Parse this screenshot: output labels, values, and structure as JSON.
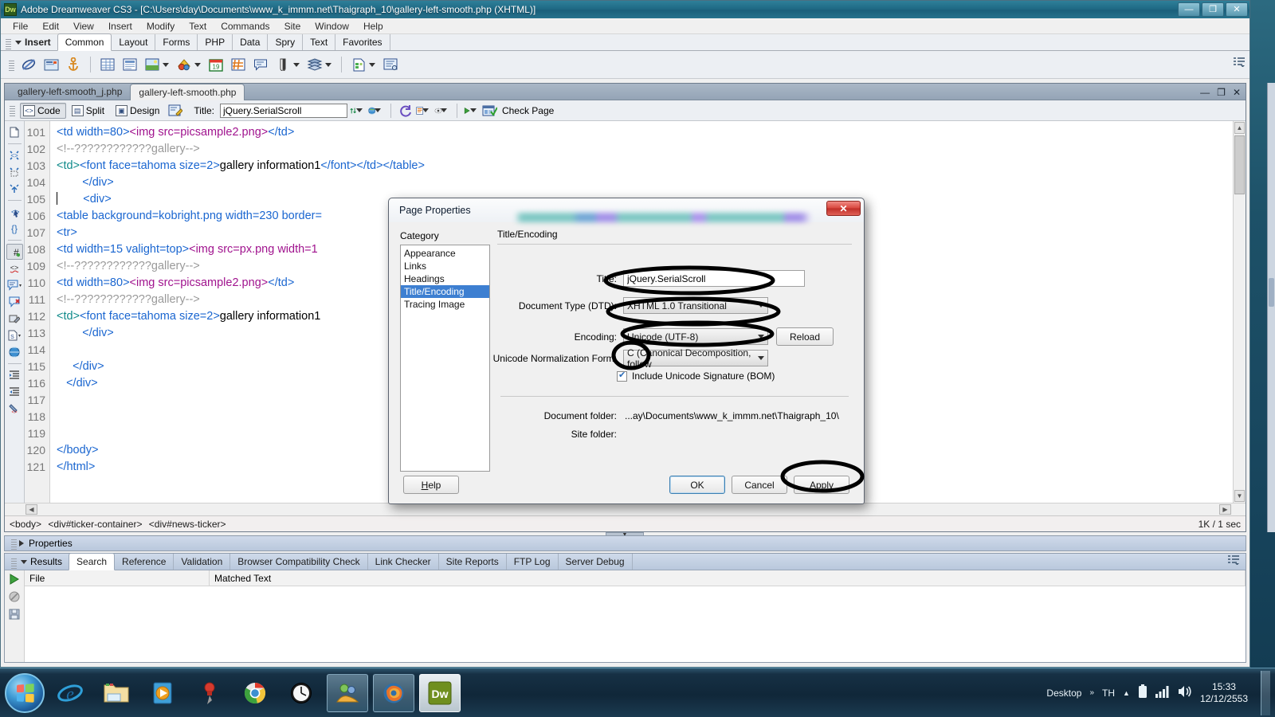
{
  "window": {
    "title": "Adobe Dreamweaver CS3 - [C:\\Users\\day\\Documents\\www_k_immm.net\\Thaigraph_10\\gallery-left-smooth.php (XHTML)]",
    "logo_text": "Dw",
    "minimize": "—",
    "restore": "❐",
    "close": "✕"
  },
  "menubar": {
    "items": [
      "File",
      "Edit",
      "View",
      "Insert",
      "Modify",
      "Text",
      "Commands",
      "Site",
      "Window",
      "Help"
    ]
  },
  "insertbar": {
    "label": "Insert",
    "tabs": [
      "Common",
      "Layout",
      "Forms",
      "PHP",
      "Data",
      "Spry",
      "Text",
      "Favorites"
    ],
    "active_tab": "Common",
    "icons": [
      {
        "name": "hyperlink-icon",
        "glyph": "🔗"
      },
      {
        "name": "email-link-icon",
        "glyph": "✉"
      },
      {
        "name": "named-anchor-icon",
        "glyph": "⚓"
      },
      {
        "name": "table-icon",
        "glyph": "▦"
      },
      {
        "name": "insert-div-tag-icon",
        "glyph": "▤"
      },
      {
        "name": "image-icon",
        "glyph": "🖼"
      },
      {
        "name": "media-icon",
        "glyph": "🎬"
      },
      {
        "name": "date-icon",
        "glyph": "19"
      },
      {
        "name": "server-side-include-icon",
        "glyph": "#"
      },
      {
        "name": "comment-icon",
        "glyph": "💬"
      },
      {
        "name": "head-tag-icon",
        "glyph": "◑"
      },
      {
        "name": "script-icon",
        "glyph": "◈"
      },
      {
        "name": "templates-icon",
        "glyph": "📄"
      },
      {
        "name": "tag-chooser-icon",
        "glyph": "🗒"
      }
    ],
    "right_icon": "panel-options-icon"
  },
  "document": {
    "tabs": [
      {
        "label": "gallery-left-smooth_j.php",
        "active": false
      },
      {
        "label": "gallery-left-smooth.php",
        "active": true
      }
    ],
    "win_controls": [
      "—",
      "❐",
      "✕"
    ],
    "toolbar": {
      "view_buttons": [
        {
          "label": "Code",
          "active": true
        },
        {
          "label": "Split",
          "active": false
        },
        {
          "label": "Design",
          "active": false
        }
      ],
      "live_view_icon": "live-code-icon",
      "title_label": "Title:",
      "title_value": "jQuery.SerialScroll",
      "icons": [
        {
          "name": "file-management-icon",
          "glyph": "⇅"
        },
        {
          "name": "preview-in-browser-icon",
          "glyph": "🌐"
        },
        {
          "name": "refresh-design-view-icon",
          "glyph": "↻"
        },
        {
          "name": "view-options-icon",
          "glyph": "▤"
        },
        {
          "name": "visual-aids-icon",
          "glyph": "◎"
        },
        {
          "name": "validate-markup-icon",
          "glyph": "▶"
        }
      ],
      "check_page_label": "Check Page"
    },
    "code_sidebar_icons": [
      "open-documents-icon",
      "collapse-full-tag-icon",
      "collapse-outside-selection-icon",
      "expand-all-icon",
      "select-parent-tag-icon",
      "balance-braces-icon",
      "line-numbers-icon",
      "highlight-invalid-code-icon",
      "apply-comment-icon",
      "remove-comment-icon",
      "wrap-tag-icon",
      "recent-snippets-icon",
      "move-css-rules-icon",
      "indent-code-icon",
      "outdent-code-icon",
      "format-source-code-icon"
    ],
    "lines": [
      {
        "n": "101",
        "tokens": [
          {
            "t": "tag",
            "s": "<td width="
          },
          {
            "t": "num",
            "s": "80"
          },
          {
            "t": "tag",
            "s": ">"
          },
          {
            "t": "str",
            "s": "<img src=picsample2.png>"
          },
          {
            "t": "tag",
            "s": "</td>"
          }
        ]
      },
      {
        "n": "102",
        "tokens": [
          {
            "t": "cmt",
            "s": "<!--????????????gallery-->"
          }
        ]
      },
      {
        "n": "103",
        "tokens": [
          {
            "t": "tag2",
            "s": "<td>"
          },
          {
            "t": "tag",
            "s": "<font face=tahoma size="
          },
          {
            "t": "num",
            "s": "2"
          },
          {
            "t": "tag",
            "s": ">"
          },
          {
            "t": "txt",
            "s": "gallery information1"
          },
          {
            "t": "tag",
            "s": "</font></td></table>"
          }
        ]
      },
      {
        "n": "104",
        "tokens": [
          {
            "t": "tag",
            "s": "        </div>"
          }
        ]
      },
      {
        "n": "105",
        "tokens": [
          {
            "t": "caret",
            "s": ""
          },
          {
            "t": "tag",
            "s": "        <div>"
          }
        ]
      },
      {
        "n": "106",
        "tokens": [
          {
            "t": "tag",
            "s": "<table background=kobright.png width="
          },
          {
            "t": "num",
            "s": "230"
          },
          {
            "t": "tag",
            "s": " border="
          }
        ]
      },
      {
        "n": "107",
        "tokens": [
          {
            "t": "tag",
            "s": "<tr>"
          }
        ]
      },
      {
        "n": "108",
        "tokens": [
          {
            "t": "tag",
            "s": "<td width="
          },
          {
            "t": "num",
            "s": "15"
          },
          {
            "t": "tag",
            "s": " valight=top>"
          },
          {
            "t": "str",
            "s": "<img src=px.png width=1"
          }
        ]
      },
      {
        "n": "109",
        "tokens": [
          {
            "t": "cmt",
            "s": "<!--????????????gallery-->"
          }
        ]
      },
      {
        "n": "110",
        "tokens": [
          {
            "t": "tag",
            "s": "<td width="
          },
          {
            "t": "num",
            "s": "80"
          },
          {
            "t": "tag",
            "s": ">"
          },
          {
            "t": "str",
            "s": "<img src=picsample2.png>"
          },
          {
            "t": "tag",
            "s": "</td>"
          }
        ]
      },
      {
        "n": "111",
        "tokens": [
          {
            "t": "cmt",
            "s": "<!--????????????gallery-->"
          }
        ]
      },
      {
        "n": "112",
        "tokens": [
          {
            "t": "tag2",
            "s": "<td>"
          },
          {
            "t": "tag",
            "s": "<font face=tahoma size="
          },
          {
            "t": "num",
            "s": "2"
          },
          {
            "t": "tag",
            "s": ">"
          },
          {
            "t": "txt",
            "s": "gallery information1"
          }
        ]
      },
      {
        "n": "113",
        "tokens": [
          {
            "t": "tag",
            "s": "        </div>"
          }
        ]
      },
      {
        "n": "114",
        "tokens": []
      },
      {
        "n": "115",
        "tokens": [
          {
            "t": "tag",
            "s": "     </div>"
          }
        ]
      },
      {
        "n": "116",
        "tokens": [
          {
            "t": "tag",
            "s": "   </div>"
          }
        ]
      },
      {
        "n": "117",
        "tokens": []
      },
      {
        "n": "118",
        "tokens": []
      },
      {
        "n": "119",
        "tokens": []
      },
      {
        "n": "120",
        "tokens": [
          {
            "t": "tag",
            "s": "</body>"
          }
        ]
      },
      {
        "n": "121",
        "tokens": [
          {
            "t": "tag",
            "s": "</html>"
          }
        ]
      }
    ],
    "tag_selector": [
      "<body>",
      "<div#ticker-container>",
      "<div#news-ticker>"
    ],
    "doc_size": "1K / 1 sec"
  },
  "panels": {
    "properties_label": "Properties",
    "results_label": "Results",
    "results_tabs": [
      "Search",
      "Reference",
      "Validation",
      "Browser Compatibility Check",
      "Link Checker",
      "Site Reports",
      "FTP Log",
      "Server Debug"
    ],
    "results_active_tab": "Search",
    "results_columns": [
      "File",
      "Matched Text"
    ],
    "results_tool_icons": [
      "run-search-icon",
      "stop-icon",
      "save-report-icon"
    ],
    "results_right_icon": "panel-options-icon"
  },
  "dialog": {
    "title": "Page Properties",
    "close": "✕",
    "category_label": "Category",
    "categories": [
      {
        "label": "Appearance",
        "selected": false
      },
      {
        "label": "Links",
        "selected": false
      },
      {
        "label": "Headings",
        "selected": false
      },
      {
        "label": "Title/Encoding",
        "selected": true
      },
      {
        "label": "Tracing Image",
        "selected": false
      }
    ],
    "pane_title": "Title/Encoding",
    "fields": {
      "title_label": "Title:",
      "title_value": "jQuery.SerialScroll",
      "dtd_label": "Document Type (DTD):",
      "dtd_value": "XHTML 1.0 Transitional",
      "encoding_label": "Encoding:",
      "encoding_value": "Unicode (UTF-8)",
      "reload_label": "Reload",
      "normalization_label": "Unicode Normalization Form:",
      "normalization_value": "C (Canonical Decomposition, follow",
      "bom_label": "Include Unicode Signature (BOM)",
      "bom_checked": true,
      "document_folder_label": "Document folder:",
      "document_folder_value": "...ay\\Documents\\www_k_immm.net\\Thaigraph_10\\",
      "site_folder_label": "Site folder:",
      "site_folder_value": ""
    },
    "buttons": {
      "help": "Help",
      "ok": "OK",
      "cancel": "Cancel",
      "apply": "Apply"
    },
    "annotations": [
      {
        "name": "annotation-ellipse-dtd",
        "target": "Document Type (DTD)"
      },
      {
        "name": "annotation-ellipse-encoding",
        "target": "Encoding"
      },
      {
        "name": "annotation-ellipse-normalization",
        "target": "Unicode Normalization Form"
      },
      {
        "name": "annotation-ellipse-bom",
        "target": "Include Unicode Signature (BOM)"
      },
      {
        "name": "annotation-ellipse-apply",
        "target": "Apply"
      }
    ]
  },
  "taskbar": {
    "start_label": "start-orb",
    "items": [
      {
        "name": "taskbar-internet-explorer",
        "glyph": "e"
      },
      {
        "name": "taskbar-windows-explorer",
        "glyph": "📁"
      },
      {
        "name": "taskbar-media-player",
        "glyph": "▶"
      },
      {
        "name": "taskbar-pin-app",
        "glyph": "📌"
      },
      {
        "name": "taskbar-google-chrome",
        "glyph": "●"
      },
      {
        "name": "taskbar-clock-app",
        "glyph": "🕓"
      },
      {
        "name": "taskbar-messenger",
        "glyph": "👥"
      },
      {
        "name": "taskbar-firefox",
        "glyph": "🦊"
      },
      {
        "name": "taskbar-dreamweaver",
        "glyph": "Dw"
      }
    ],
    "tray": {
      "desktop_label": "Desktop",
      "overflow": "»",
      "language": "TH",
      "show_hidden": "▲",
      "battery_icon": "battery-icon",
      "network_icon": "network-signal-icon",
      "volume_icon": "volume-icon",
      "time": "15:33",
      "date": "12/12/2553"
    }
  },
  "colors": {
    "accent": "#1f6a85",
    "selection": "#3d7fd1",
    "tag": "#1a66d0",
    "string": "#a0138e",
    "comment": "#9a9a9a",
    "taskbar": "#102638"
  }
}
